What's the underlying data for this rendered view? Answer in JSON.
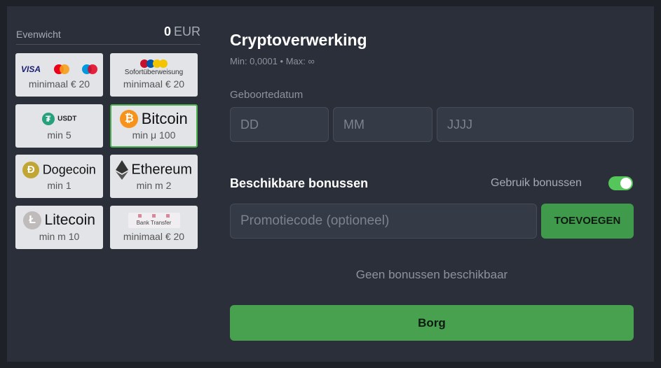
{
  "balance": {
    "label": "Evenwicht",
    "amount": "0",
    "currency": "EUR"
  },
  "payment_methods": [
    {
      "id": "cards",
      "logos": [
        "VISA",
        "mastercard",
        "maestro"
      ],
      "min": "minimaal € 20"
    },
    {
      "id": "sofort",
      "logo_text": "Sofortüberweisung",
      "min": "minimaal € 20"
    },
    {
      "id": "usdt",
      "name": "USDT",
      "min": "min 5"
    },
    {
      "id": "bitcoin",
      "name": "Bitcoin",
      "min": "min μ 100",
      "selected": true
    },
    {
      "id": "dogecoin",
      "name": "Dogecoin",
      "min": "min 1"
    },
    {
      "id": "ethereum",
      "name": "Ethereum",
      "min": "min m 2"
    },
    {
      "id": "litecoin",
      "name": "Litecoin",
      "min": "min m 10"
    },
    {
      "id": "bank",
      "logo_text": "Bank Transfer",
      "min": "minimaal € 20"
    }
  ],
  "form": {
    "title": "Cryptoverwerking",
    "limits": "Min: 0,0001 • Max: ∞",
    "dob_label": "Geboortedatum",
    "dob_day_placeholder": "DD",
    "dob_month_placeholder": "MM",
    "dob_year_placeholder": "JJJJ",
    "bonus_title": "Beschikbare bonussen",
    "use_bonus_label": "Gebruik bonussen",
    "use_bonus_enabled": true,
    "promo_placeholder": "Promotiecode (optioneel)",
    "add_button": "TOEVOEGEN",
    "no_bonus": "Geen bonussen beschikbaar",
    "submit": "Borg"
  },
  "colors": {
    "accent_green": "#47a14f",
    "toggle_green": "#55c65a",
    "panel": "#2a2f3a",
    "tile": "#e2e4e8"
  }
}
